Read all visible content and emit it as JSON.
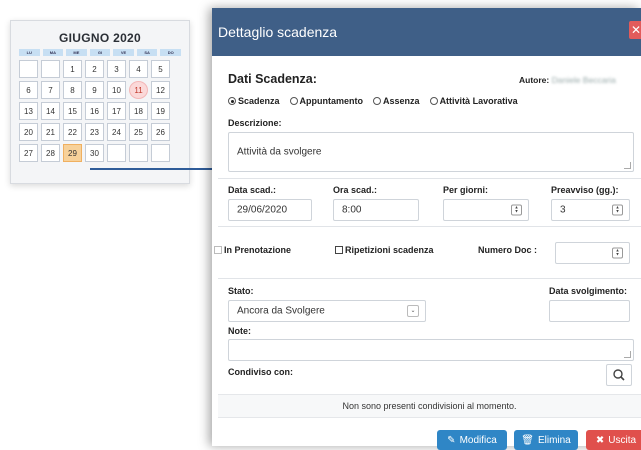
{
  "calendar": {
    "title": "GIUGNO 2020",
    "weekdays": [
      "LU",
      "MA",
      "ME",
      "GI",
      "VE",
      "SA",
      "DO"
    ],
    "weeks": [
      [
        "",
        "",
        "1",
        "2",
        "3",
        "4",
        "5"
      ],
      [
        "6",
        "7",
        "8",
        "9",
        "10",
        "11",
        "12"
      ],
      [
        "13",
        "14",
        "15",
        "16",
        "17",
        "18",
        "19"
      ],
      [
        "20",
        "21",
        "22",
        "23",
        "24",
        "25",
        "26"
      ],
      [
        "27",
        "28",
        "29",
        "30",
        "",
        "",
        ""
      ]
    ],
    "highlighted_day": "11",
    "selected_day": "29"
  },
  "modal": {
    "title": "Dettaglio scadenza",
    "section_title": "Dati Scadenza:",
    "author_label": "Autore:",
    "author_value": "Daniele Beccaria",
    "type_options": [
      "Scadenza",
      "Appuntamento",
      "Assenza",
      "Attività Lavorativa"
    ],
    "type_selected": "Scadenza",
    "description_label": "Descrizione:",
    "description_value": "Attività da svolgere",
    "date_label": "Data scad.:",
    "date_value": "29/06/2020",
    "time_label": "Ora scad.:",
    "time_value": "8:00",
    "days_label": "Per giorni:",
    "days_value": "",
    "notice_label": "Preavviso (gg.):",
    "notice_value": "3",
    "in_prenotazione_label": "In Prenotazione",
    "ripetizioni_label": "Ripetizioni scadenza",
    "numero_doc_label": "Numero Doc :",
    "stato_label": "Stato:",
    "stato_value": "Ancora da Svolgere",
    "data_svolgimento_label": "Data svolgimento:",
    "note_label": "Note:",
    "condiviso_label": "Condiviso con:",
    "condiviso_empty": "Non sono presenti condivisioni al momento.",
    "buttons": {
      "modifica": "Modifica",
      "elimina": "Elimina",
      "uscita": "Uscita"
    }
  },
  "colors": {
    "header": "#3f5f87",
    "primary_button": "#2f86c6",
    "danger_button": "#e0504c",
    "selected_day": "#f7d19a",
    "holiday_day": "#fbd9d9"
  }
}
